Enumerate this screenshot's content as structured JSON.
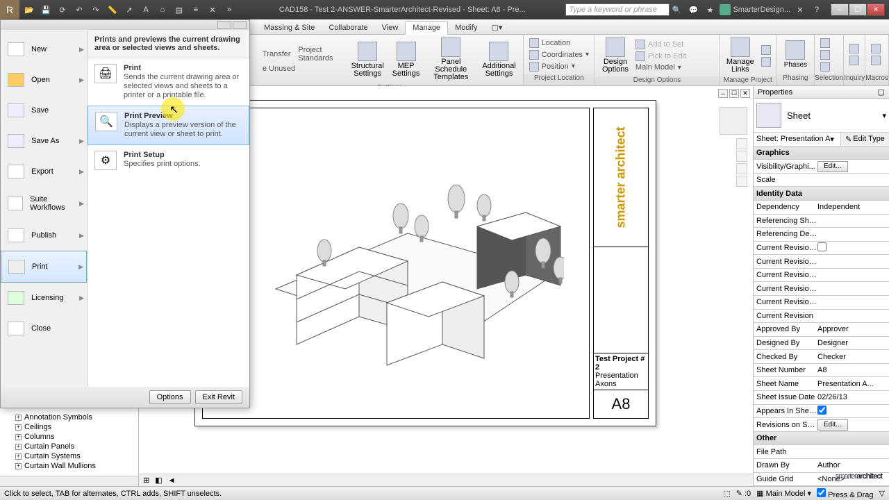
{
  "title": "CAD158 - Test 2-ANSWER-SmarterArchitect-Revised - Sheet: A8 - Pre...",
  "search_placeholder": "Type a keyword or phrase",
  "sign_in": "SmarterDesign...",
  "tabs": {
    "massing": "Massing & Site",
    "collab": "Collaborate",
    "view": "View",
    "manage": "Manage",
    "modify": "Modify"
  },
  "ribbon": {
    "transfer": "Transfer",
    "project_standards": "Project Standards",
    "purge": "e Unused",
    "structural": "Structural",
    "structural2": "Settings",
    "mep": "MEP",
    "mep2": "Settings",
    "panel": "Panel Schedule",
    "panel2": "Templates",
    "additional": "Additional",
    "additional2": "Settings",
    "location": "Location",
    "coordinates": "Coordinates",
    "position": "Position",
    "design": "Design",
    "options": "Options",
    "main_model": "Main Model",
    "add_set": "Add to Set",
    "pick_edit": "Pick to Edit",
    "manage_links": "Manage",
    "links2": "Links",
    "phases": "Phases",
    "grp_settings": "Settings",
    "grp_loc": "Project Location",
    "grp_design": "Design Options",
    "grp_manage": "Manage Project",
    "grp_phasing": "Phasing",
    "grp_selection": "Selection",
    "grp_inquiry": "Inquiry",
    "grp_macros": "Macros"
  },
  "app_menu": {
    "header": "Prints and previews the current drawing area or selected views and sheets.",
    "new": "New",
    "open": "Open",
    "save": "Save",
    "save_as": "Save As",
    "export": "Export",
    "suite": "Suite Workflows",
    "publish": "Publish",
    "print": "Print",
    "licensing": "Licensing",
    "close": "Close",
    "options": "Options",
    "exit": "Exit Revit",
    "sub_print_t": "Print",
    "sub_print_d": "Sends the current drawing area or selected views and sheets to a printer or a printable file.",
    "sub_preview_t": "Print Preview",
    "sub_preview_d": "Displays a preview version of the current view or sheet to print.",
    "sub_setup_t": "Print Setup",
    "sub_setup_d": "Specifies print options."
  },
  "browser": {
    "items": [
      "Annotation Symbols",
      "Ceilings",
      "Columns",
      "Curtain Panels",
      "Curtain Systems",
      "Curtain Wall Mullions"
    ]
  },
  "titleblock": {
    "brand": "smarter architect",
    "proj": "Test Project # 2",
    "view": "Presentation Axons",
    "num": "A8"
  },
  "props": {
    "title": "Properties",
    "type": "Sheet",
    "selector": "Sheet: Presentation A",
    "edit_type": "Edit Type",
    "graphics": "Graphics",
    "vis": "Visibility/Graphi...",
    "edit": "Edit...",
    "scale": "Scale",
    "identity": "Identity Data",
    "dep": "Dependency",
    "dep_v": "Independent",
    "ref_she": "Referencing She...",
    "ref_det": "Referencing Det...",
    "cur_rev": "Current Revision...",
    "cur_rev2": "Current Revision",
    "approved": "Approved By",
    "approved_v": "Approver",
    "designed": "Designed By",
    "designed_v": "Designer",
    "checked": "Checked By",
    "checked_v": "Checker",
    "sheet_num": "Sheet Number",
    "sheet_num_v": "A8",
    "sheet_name": "Sheet Name",
    "sheet_name_v": "Presentation A...",
    "issue": "Sheet Issue Date",
    "issue_v": "02/26/13",
    "appears": "Appears In Shee...",
    "rev_sh": "Revisions on Sh...",
    "other": "Other",
    "file_path": "File Path",
    "drawn": "Drawn By",
    "drawn_v": "Author",
    "guide": "Guide Grid",
    "guide_v": "<None>"
  },
  "status": {
    "hint": "Click to select, TAB for alternates, CTRL adds, SHIFT unselects.",
    "model": "Main Model",
    "press": "Press & Drag",
    "zero": ":0"
  },
  "watermark1": "smarter",
  "watermark2": "architect"
}
